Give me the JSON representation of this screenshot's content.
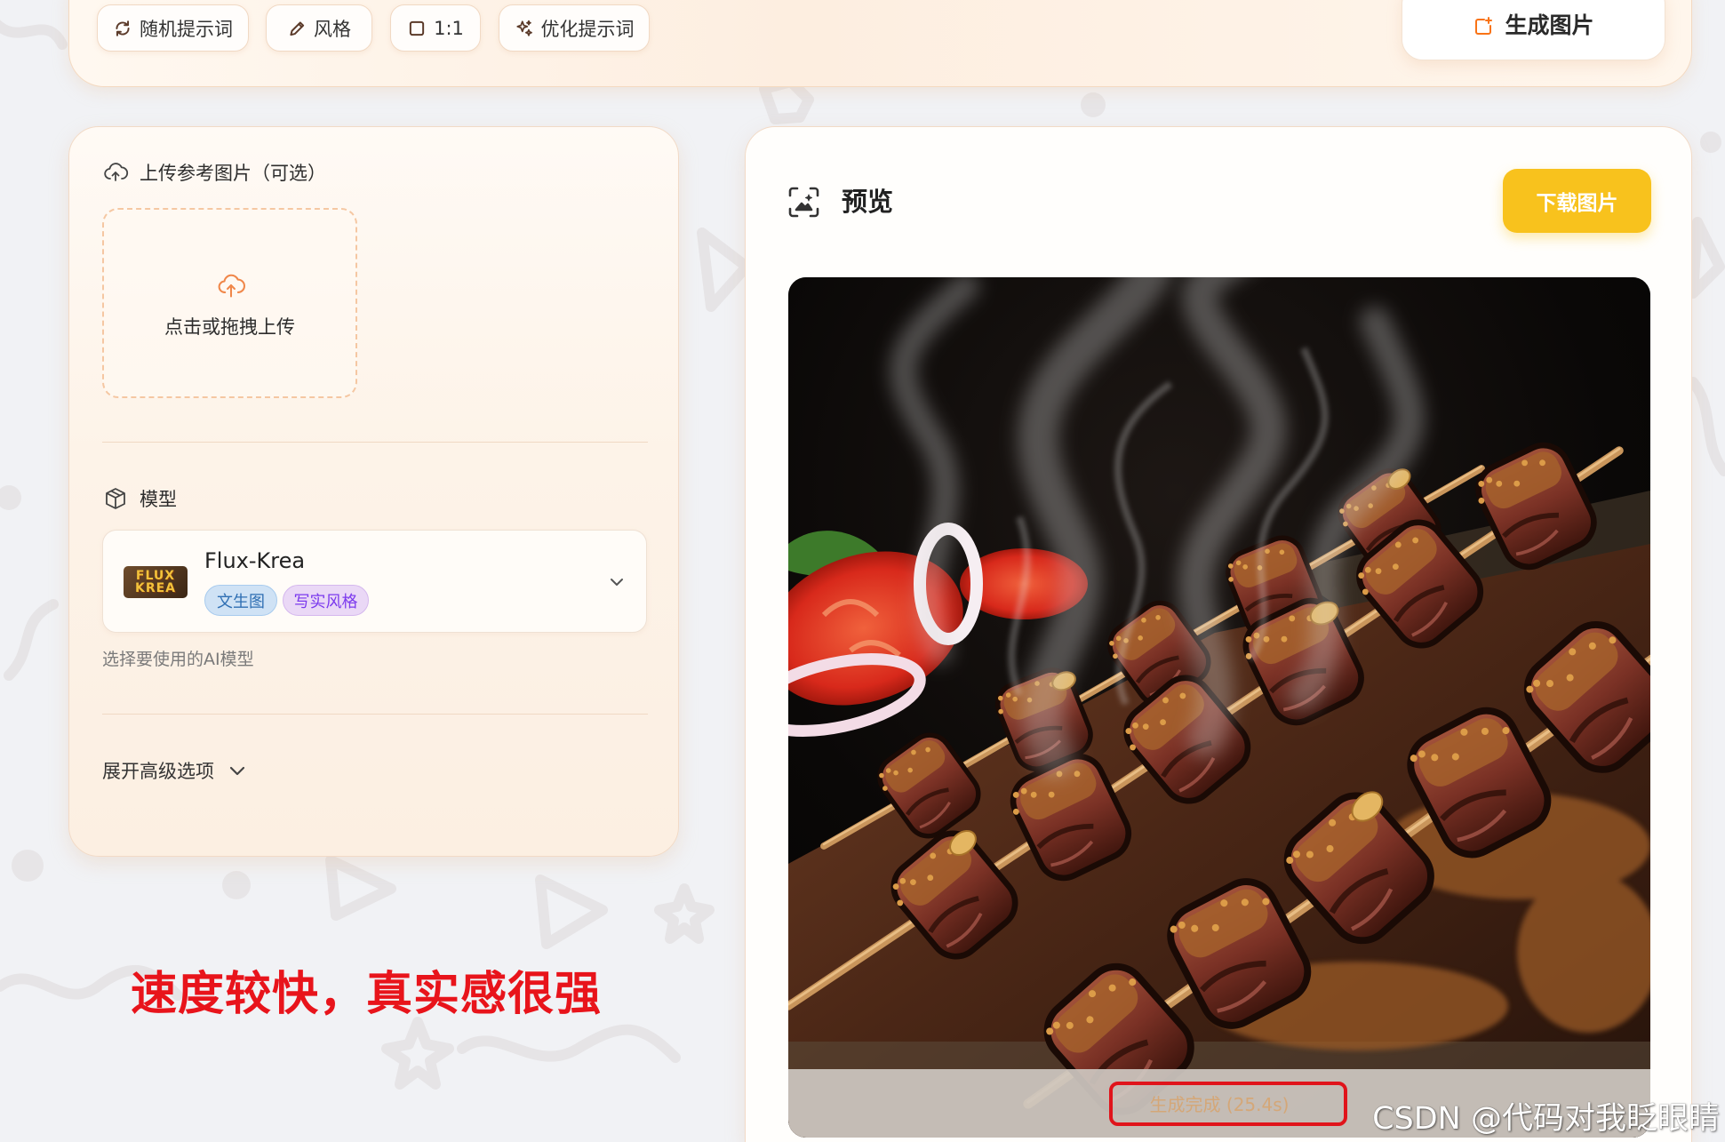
{
  "toolbar": {
    "random_prompt_label": "随机提示词",
    "style_label": "风格",
    "ratio_label": "1:1",
    "optimize_prompt_label": "优化提示词",
    "generate_label": "生成图片"
  },
  "upload": {
    "title": "上传参考图片（可选）",
    "dropzone_text": "点击或拖拽上传"
  },
  "model": {
    "label": "模型",
    "selected": {
      "name": "Flux-Krea",
      "logo_top": "FLUX",
      "logo_bottom": "KREA",
      "tags": [
        "文生图",
        "写实风格"
      ]
    },
    "hint": "选择要使用的AI模型"
  },
  "advanced": {
    "toggle_label": "展开高级选项"
  },
  "preview": {
    "title": "预览",
    "download_label": "下载图片",
    "status": "生成完成 (25.4s)"
  },
  "annotation": "速度较快，真实感很强",
  "watermark": "CSDN @代码对我眨眼睛",
  "icons": {
    "random_prompt": "refresh-icon",
    "style": "pencil-icon",
    "ratio": "square-icon",
    "optimize_prompt": "sparkles-icon",
    "generate": "image-plus-icon",
    "upload_title": "cloud-upload-icon",
    "dropzone": "cloud-upload-icon",
    "model": "cube-icon",
    "model_select": "chevron-down-icon",
    "advanced": "chevron-down-icon",
    "preview": "image-frame-icon"
  },
  "colors": {
    "accent": "#f97316",
    "download_button": "#f8c21d",
    "annotation_red": "#e8141b",
    "tag_text2image": "#2f6fb3",
    "tag_realistic": "#7c3aed",
    "panel_border": "#f2dac6"
  }
}
